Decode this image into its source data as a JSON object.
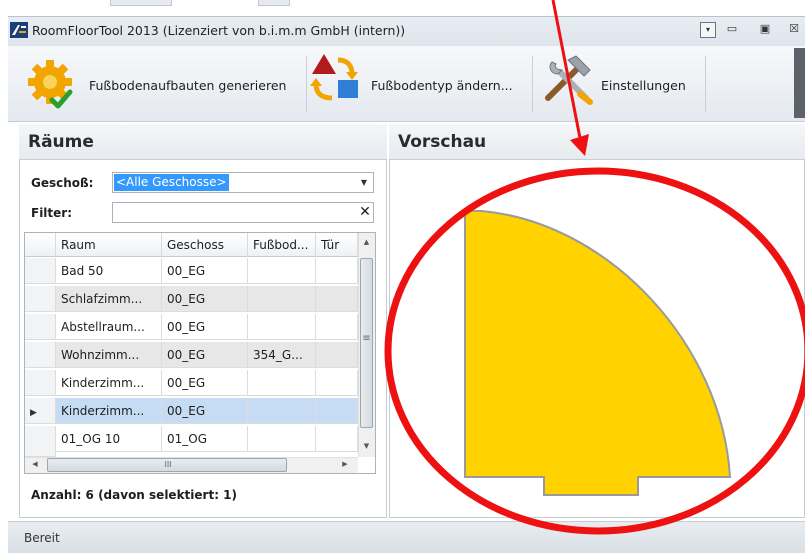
{
  "window": {
    "title": "RoomFloorTool 2013 (Lizenziert von b.i.m.m GmbH (intern))",
    "dropdown_glyph": "▾",
    "minimize_glyph": "▭",
    "maximize_glyph": "▣",
    "close_glyph": "☒"
  },
  "toolbar": {
    "items": [
      {
        "label": "Fußbodenaufbauten generieren",
        "icon": "gear-check-icon"
      },
      {
        "label": "Fußbodentyp ändern...",
        "icon": "shapes-swap-icon"
      },
      {
        "label": "Einstellungen",
        "icon": "hammer-wrench-icon"
      }
    ]
  },
  "rooms_panel": {
    "title": "Räume",
    "floor_label": "Geschoß:",
    "floor_value": "<Alle Geschosse>",
    "filter_label": "Filter:",
    "filter_value": "",
    "filter_clear": "✕",
    "columns": [
      "Raum",
      "Geschoss",
      "Fußbod...",
      "Tür"
    ],
    "rows": [
      {
        "raum": "Bad 50",
        "geschoss": "00_EG",
        "fussboden": "",
        "tuer": ""
      },
      {
        "raum": "Schlafzimm...",
        "geschoss": "00_EG",
        "fussboden": "",
        "tuer": ""
      },
      {
        "raum": "Abstellraum...",
        "geschoss": "00_EG",
        "fussboden": "",
        "tuer": ""
      },
      {
        "raum": "Wohnzimm...",
        "geschoss": "00_EG",
        "fussboden": "354_G...",
        "tuer": ""
      },
      {
        "raum": "Kinderzimm...",
        "geschoss": "00_EG",
        "fussboden": "",
        "tuer": ""
      },
      {
        "raum": "Kinderzimm...",
        "geschoss": "00_EG",
        "fussboden": "",
        "tuer": ""
      },
      {
        "raum": "01_OG 10",
        "geschoss": "01_OG",
        "fussboden": "",
        "tuer": ""
      }
    ],
    "selected_row_index": 5,
    "count_text": "Anzahl: 6 (davon selektiert: 1)",
    "row_marker": "▶",
    "scroll_up": "▲",
    "scroll_down": "▼",
    "scroll_left": "◀",
    "scroll_right": "▶",
    "thumb_grip_v": "≡",
    "thumb_grip_h": "III"
  },
  "preview_panel": {
    "title": "Vorschau",
    "shape_fill": "#ffd200",
    "shape_stroke": "#9a9a9a"
  },
  "annotation": {
    "color": "#ee1111"
  },
  "status": {
    "text": "Bereit"
  }
}
